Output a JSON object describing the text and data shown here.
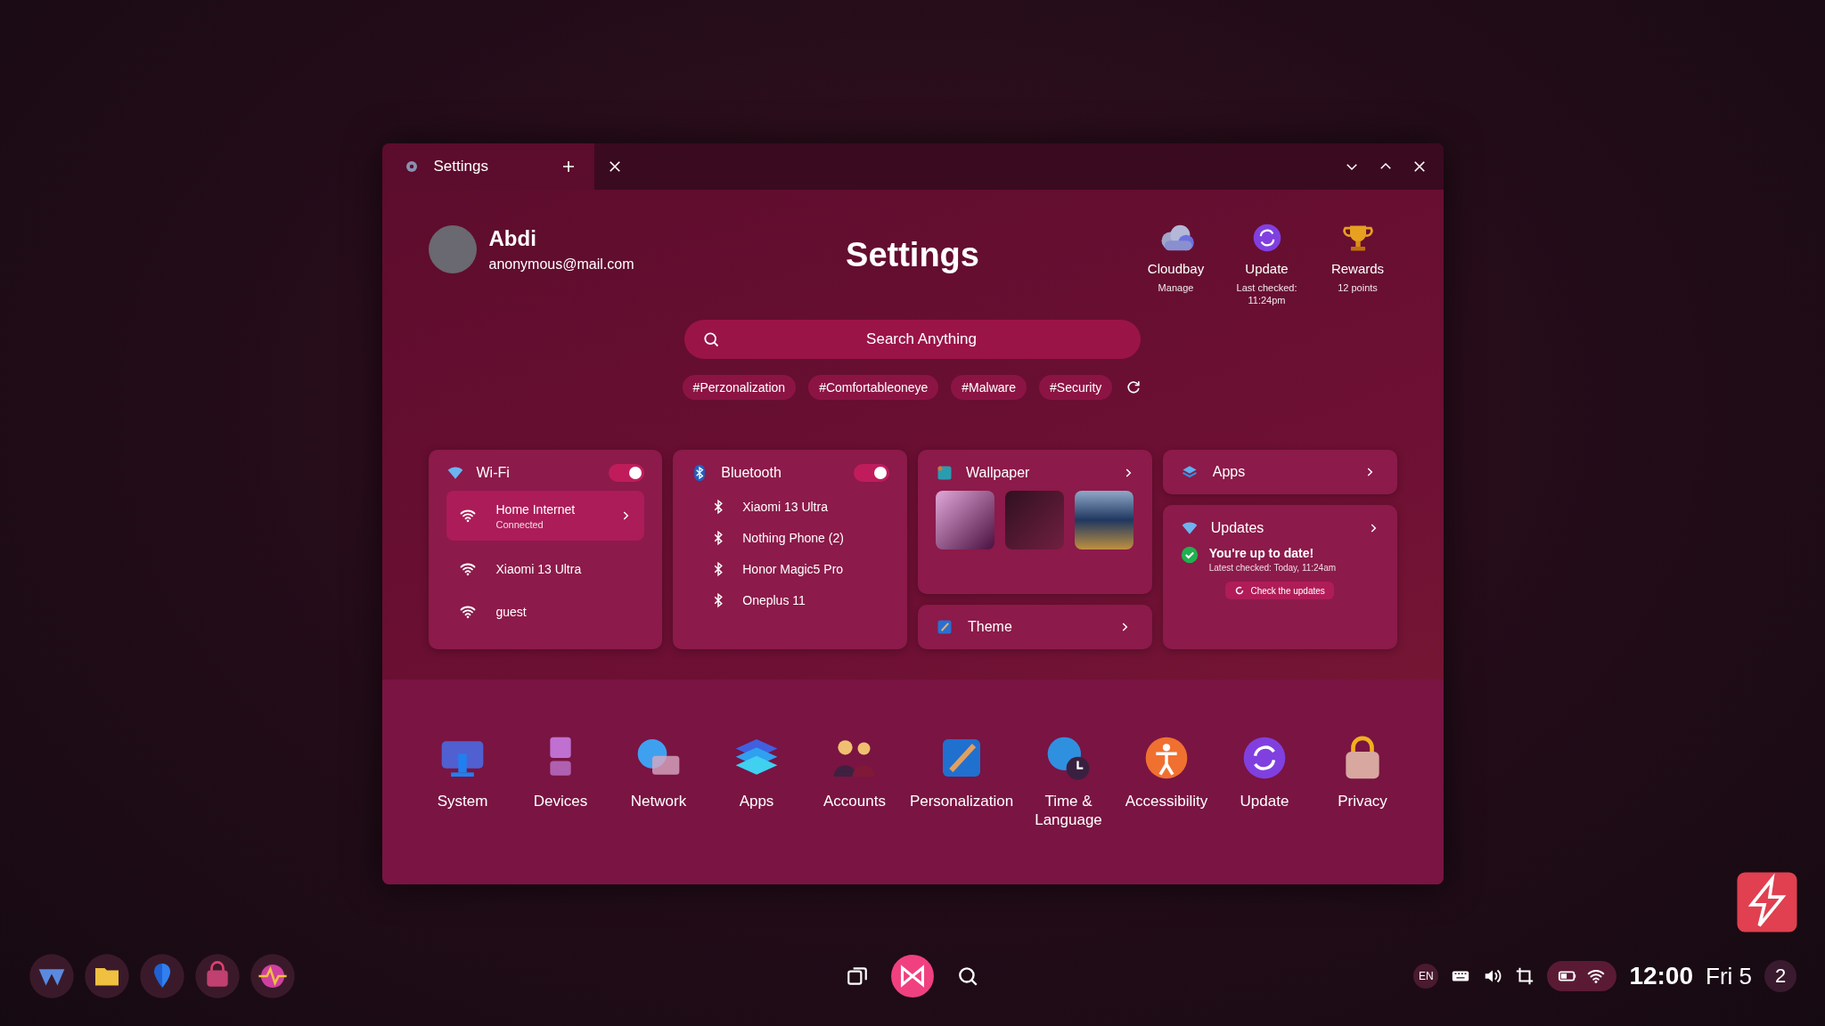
{
  "window": {
    "tab_title": "Settings"
  },
  "profile": {
    "name": "Abdi",
    "email": "anonymous@mail.com"
  },
  "title": "Settings",
  "quick_links": [
    {
      "kind": "cloud",
      "label": "Cloudbay",
      "sub": "Manage"
    },
    {
      "kind": "update",
      "label": "Update",
      "sub": "Last checked: 11:24pm"
    },
    {
      "kind": "trophy",
      "label": "Rewards",
      "sub": "12 points"
    }
  ],
  "search": {
    "placeholder": "Search Anything"
  },
  "tags": [
    "#Perzonalization",
    "#Comfortableoneye",
    "#Malware",
    "#Security"
  ],
  "wifi": {
    "title": "Wi-Fi",
    "on": true,
    "networks": [
      {
        "name": "Home Internet",
        "status": "Connected",
        "selected": true
      },
      {
        "name": "Xiaomi 13 Ultra",
        "selected": false
      },
      {
        "name": "guest",
        "selected": false
      }
    ]
  },
  "bluetooth": {
    "title": "Bluetooth",
    "on": true,
    "devices": [
      "Xiaomi 13 Ultra",
      "Nothing Phone (2)",
      "Honor Magic5 Pro",
      "Oneplus 11"
    ]
  },
  "wallpaper": {
    "title": "Wallpaper"
  },
  "theme": {
    "title": "Theme"
  },
  "apps": {
    "title": "Apps"
  },
  "updates": {
    "title": "Updates",
    "status": "You're up to date!",
    "checked": "Latest checked: Today, 11:24am",
    "button": "Check the updates"
  },
  "categories": [
    {
      "kind": "system",
      "label": "System"
    },
    {
      "kind": "devices",
      "label": "Devices"
    },
    {
      "kind": "network",
      "label": "Network"
    },
    {
      "kind": "apps",
      "label": "Apps"
    },
    {
      "kind": "accounts",
      "label": "Accounts"
    },
    {
      "kind": "personalization",
      "label": "Personalization"
    },
    {
      "kind": "time",
      "label": "Time & Language"
    },
    {
      "kind": "accessibility",
      "label": "Accessibility"
    },
    {
      "kind": "update",
      "label": "Update"
    },
    {
      "kind": "privacy",
      "label": "Privacy"
    }
  ],
  "taskbar": {
    "language": "EN",
    "time": "12:00",
    "date": "Fri 5",
    "badge": "2"
  }
}
